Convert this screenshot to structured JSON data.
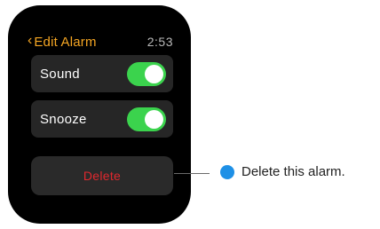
{
  "nav": {
    "back_icon": "‹",
    "title": "Edit Alarm",
    "time": "2:53"
  },
  "settings": [
    {
      "label": "Sound",
      "enabled": true
    },
    {
      "label": "Snooze",
      "enabled": true
    }
  ],
  "delete_button": {
    "label": "Delete"
  },
  "callout": {
    "text": "Delete this alarm."
  },
  "colors": {
    "accent": "#f5a623",
    "toggle_on": "#3bd34d",
    "destructive": "#e0282e",
    "callout_dot": "#1e90e6"
  }
}
